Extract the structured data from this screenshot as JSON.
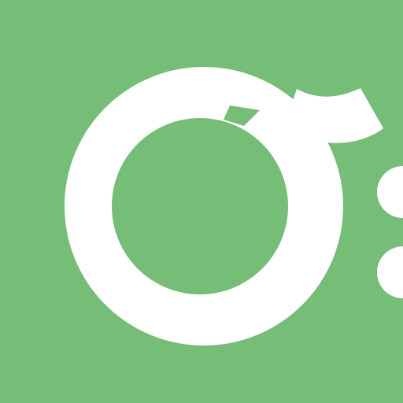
{
  "colors": {
    "background": "#76bd77",
    "mark": "#ffffff"
  },
  "icons": {
    "main": "ring-with-tail-logo-icon",
    "dots": "two-dots-icon"
  }
}
